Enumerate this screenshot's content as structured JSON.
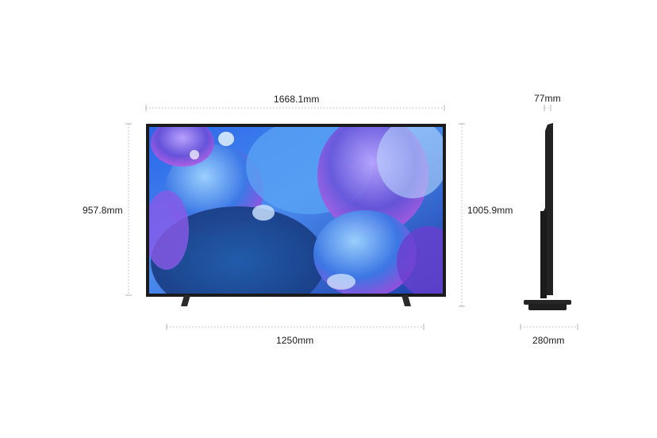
{
  "dimensions": {
    "overall_width": "1668.1mm",
    "height_without_stand": "957.8mm",
    "height_with_stand": "1005.9mm",
    "stand_width": "1250mm",
    "depth_without_stand": "77mm",
    "depth_with_stand": "280mm"
  },
  "colors": {
    "dimension_line": "#b5b5b5",
    "tv_frame": "#1b1b1b",
    "screen_primary": "#3a6fe0",
    "screen_accent": "#b45ae6"
  },
  "icons": {
    "front_view": "tv-front-illustration",
    "side_view": "tv-side-profile-illustration"
  }
}
